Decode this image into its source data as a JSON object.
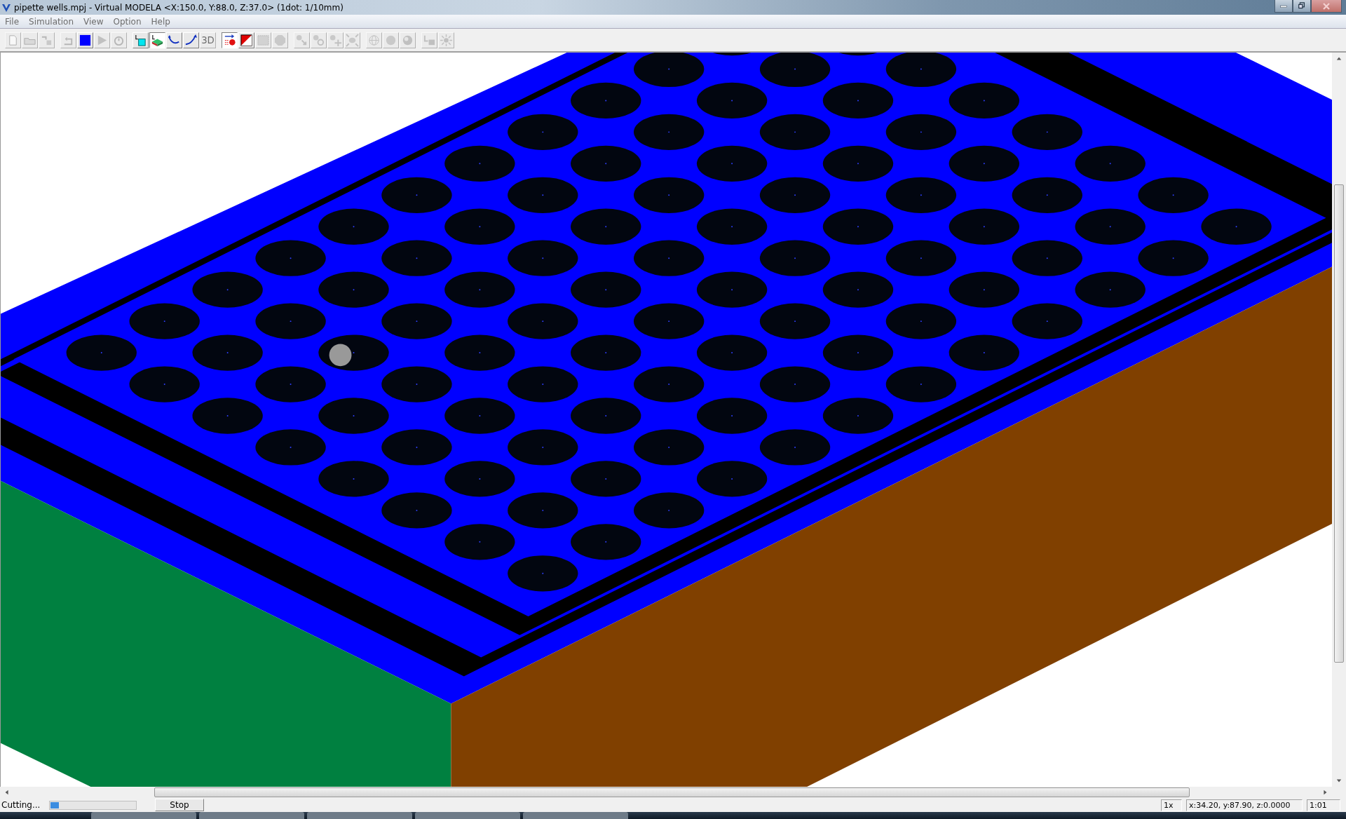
{
  "window": {
    "title": "pipette wells.mpj - Virtual MODELA <X:150.0, Y:88.0, Z:37.0> (1dot: 1/10mm)"
  },
  "menu": [
    "File",
    "Simulation",
    "View",
    "Option",
    "Help"
  ],
  "toolbar": [
    [
      {
        "kind": "page",
        "pressed": false,
        "disabled": true
      },
      {
        "kind": "folder",
        "pressed": false,
        "disabled": true
      },
      {
        "kind": "swap",
        "pressed": false,
        "disabled": true
      }
    ],
    [
      {
        "kind": "rotate",
        "pressed": false,
        "disabled": true
      },
      {
        "kind": "stop",
        "pressed": false,
        "disabled": false
      },
      {
        "kind": "play",
        "pressed": false,
        "disabled": true
      },
      {
        "kind": "timer",
        "pressed": false,
        "disabled": true
      }
    ],
    [
      {
        "kind": "cube",
        "pressed": false,
        "disabled": false
      },
      {
        "kind": "block",
        "pressed": true,
        "disabled": false
      },
      {
        "kind": "curve-down",
        "pressed": false,
        "disabled": false
      },
      {
        "kind": "curve-up",
        "pressed": false,
        "disabled": false
      },
      {
        "kind": "text3d",
        "label": "3D",
        "pressed": false,
        "disabled": true
      }
    ],
    [
      {
        "kind": "arrow-ball",
        "pressed": true,
        "disabled": false
      },
      {
        "kind": "split",
        "pressed": false,
        "disabled": false
      },
      {
        "kind": "frame",
        "pressed": false,
        "disabled": true
      },
      {
        "kind": "octagon",
        "pressed": false,
        "disabled": true
      }
    ],
    [
      {
        "kind": "zoom-move",
        "pressed": false,
        "disabled": true
      },
      {
        "kind": "zoom-in",
        "pressed": false,
        "disabled": true
      },
      {
        "kind": "zoom-target",
        "pressed": false,
        "disabled": true
      },
      {
        "kind": "zoom-fit",
        "pressed": false,
        "disabled": true
      }
    ],
    [
      {
        "kind": "sphere-wire",
        "pressed": false,
        "disabled": true
      },
      {
        "kind": "sphere-flat",
        "pressed": false,
        "disabled": true
      },
      {
        "kind": "sphere-shaded",
        "pressed": false,
        "disabled": true
      }
    ],
    [
      {
        "kind": "view-swap",
        "pressed": false,
        "disabled": true
      },
      {
        "kind": "light",
        "pressed": false,
        "disabled": true
      }
    ]
  ],
  "status_bar": {
    "message": "Cutting...",
    "progress": {
      "level": 0.1
    },
    "stop_button": "Stop",
    "zoom": "1x",
    "coordinates": "x:34.20, y:87.90, z:0.0000",
    "time": "1:01"
  }
}
